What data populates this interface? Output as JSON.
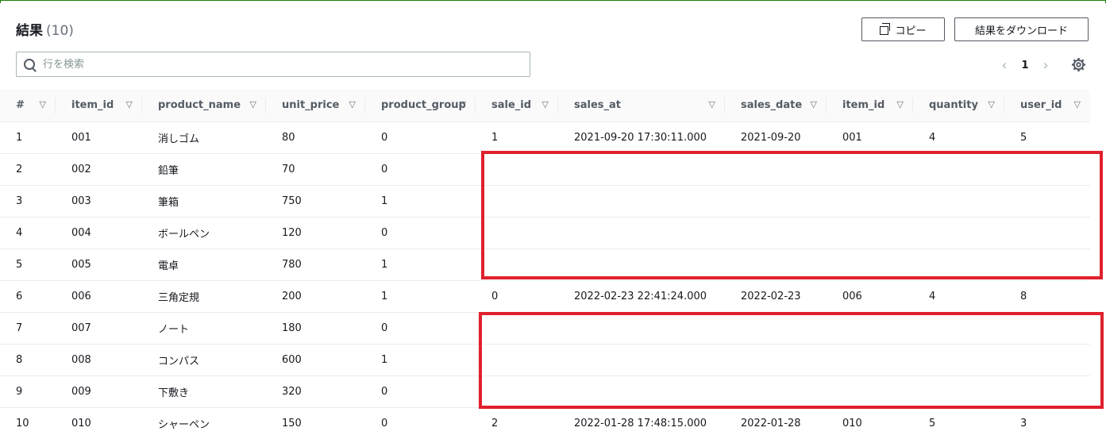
{
  "header": {
    "title": "結果",
    "count": "(10)",
    "copy_label": "コピー",
    "download_label": "結果をダウンロード"
  },
  "search": {
    "placeholder": "行を検索"
  },
  "pager": {
    "prev": "‹",
    "page": "1",
    "next": "›"
  },
  "table": {
    "columns": [
      "#",
      "item_id",
      "product_name",
      "unit_price",
      "product_group",
      "sale_id",
      "sales_at",
      "sales_date",
      "item_id",
      "quantity",
      "user_id"
    ],
    "rows": [
      [
        "1",
        "001",
        "消しゴム",
        "80",
        "0",
        "1",
        "2021-09-20 17:30:11.000",
        "2021-09-20",
        "001",
        "4",
        "5"
      ],
      [
        "2",
        "002",
        "鉛筆",
        "70",
        "0",
        "",
        "",
        "",
        "",
        "",
        ""
      ],
      [
        "3",
        "003",
        "筆箱",
        "750",
        "1",
        "",
        "",
        "",
        "",
        "",
        ""
      ],
      [
        "4",
        "004",
        "ボールペン",
        "120",
        "0",
        "",
        "",
        "",
        "",
        "",
        ""
      ],
      [
        "5",
        "005",
        "電卓",
        "780",
        "1",
        "",
        "",
        "",
        "",
        "",
        ""
      ],
      [
        "6",
        "006",
        "三角定規",
        "200",
        "1",
        "0",
        "2022-02-23 22:41:24.000",
        "2022-02-23",
        "006",
        "4",
        "8"
      ],
      [
        "7",
        "007",
        "ノート",
        "180",
        "0",
        "",
        "",
        "",
        "",
        "",
        ""
      ],
      [
        "8",
        "008",
        "コンパス",
        "600",
        "1",
        "",
        "",
        "",
        "",
        "",
        ""
      ],
      [
        "9",
        "009",
        "下敷き",
        "320",
        "0",
        "",
        "",
        "",
        "",
        "",
        ""
      ],
      [
        "10",
        "010",
        "シャーペン",
        "150",
        "0",
        "2",
        "2022-01-28 17:48:15.000",
        "2022-01-28",
        "010",
        "5",
        "3"
      ]
    ]
  },
  "colors": {
    "accent": "#1d8102",
    "highlight": "#e0202d",
    "border": "#eaeded"
  }
}
